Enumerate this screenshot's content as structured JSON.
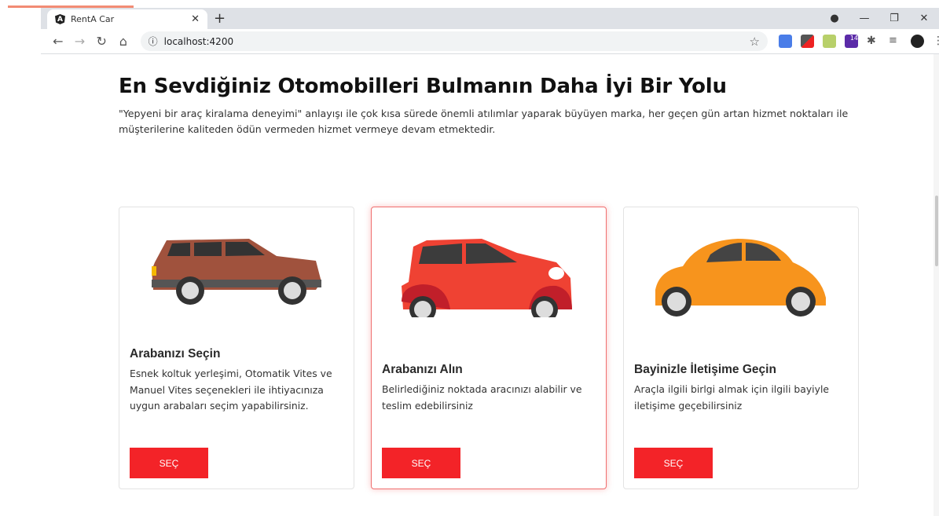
{
  "browser": {
    "tab_title": "RentA Car",
    "url": "localhost:4200",
    "extension_badge": "14"
  },
  "page": {
    "title": "En Sevdiğiniz Otomobilleri Bulmanın Daha İyi Bir Yolu",
    "lead": "\"Yepyeni bir araç kiralama deneyimi\" anlayışı ile çok kısa sürede önemli atılımlar yaparak büyüyen marka, her geçen gün artan hizmet noktaları ile müşterilerine kaliteden ödün vermeden hizmet vermeye devam etmektedir."
  },
  "cards": [
    {
      "title": "Arabanızı Seçin",
      "text": "Esnek koltuk yerleşimi, Otomatik Vites ve Manuel Vites seçenekleri ile ihtiyacınıza uygun arabaları seçim yapabilirsiniz.",
      "button": "SEÇ",
      "car_color": "#a0523d"
    },
    {
      "title": "Arabanızı Alın",
      "text": "Belirlediğiniz noktada aracınızı alabilir ve teslim edebilirsiniz",
      "button": "SEÇ",
      "car_color": "#ef4233"
    },
    {
      "title": "Bayinizle İletişime Geçin",
      "text": "Araçla ilgili birlgi almak için ilgili bayiyle iletişime geçebilirsiniz",
      "button": "SEÇ",
      "car_color": "#f7941d"
    }
  ]
}
